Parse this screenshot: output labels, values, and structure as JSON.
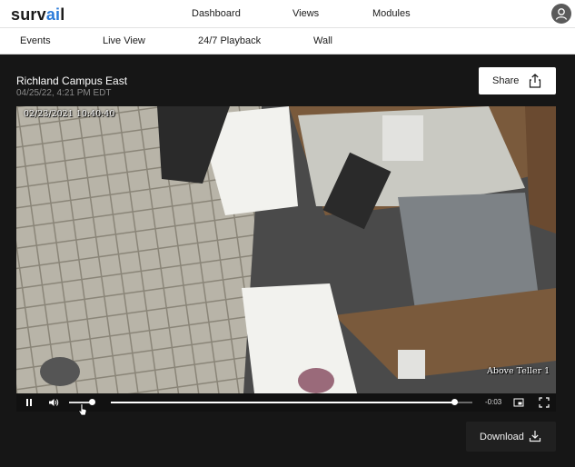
{
  "app": {
    "logo_prefix": "surv",
    "logo_accent": "ai",
    "logo_suffix": "l",
    "accent_color": "#2b7bd9"
  },
  "top_nav": [
    "Dashboard",
    "Views",
    "Modules"
  ],
  "sub_nav": [
    "Events",
    "Live View",
    "24/7 Playback",
    "Wall"
  ],
  "camera": {
    "name": "Richland Campus East",
    "timestamp": "04/25/22, 4:21 PM EDT"
  },
  "share": {
    "label": "Share",
    "icon": "share-icon"
  },
  "video": {
    "osd_timestamp": "02/23/2021 10:40:40",
    "osd_label": "Above Teller 1",
    "time_remaining": "-0:03",
    "progress": 0.95,
    "volume": 0.9
  },
  "download": {
    "label": "Download",
    "icon": "download-icon"
  }
}
